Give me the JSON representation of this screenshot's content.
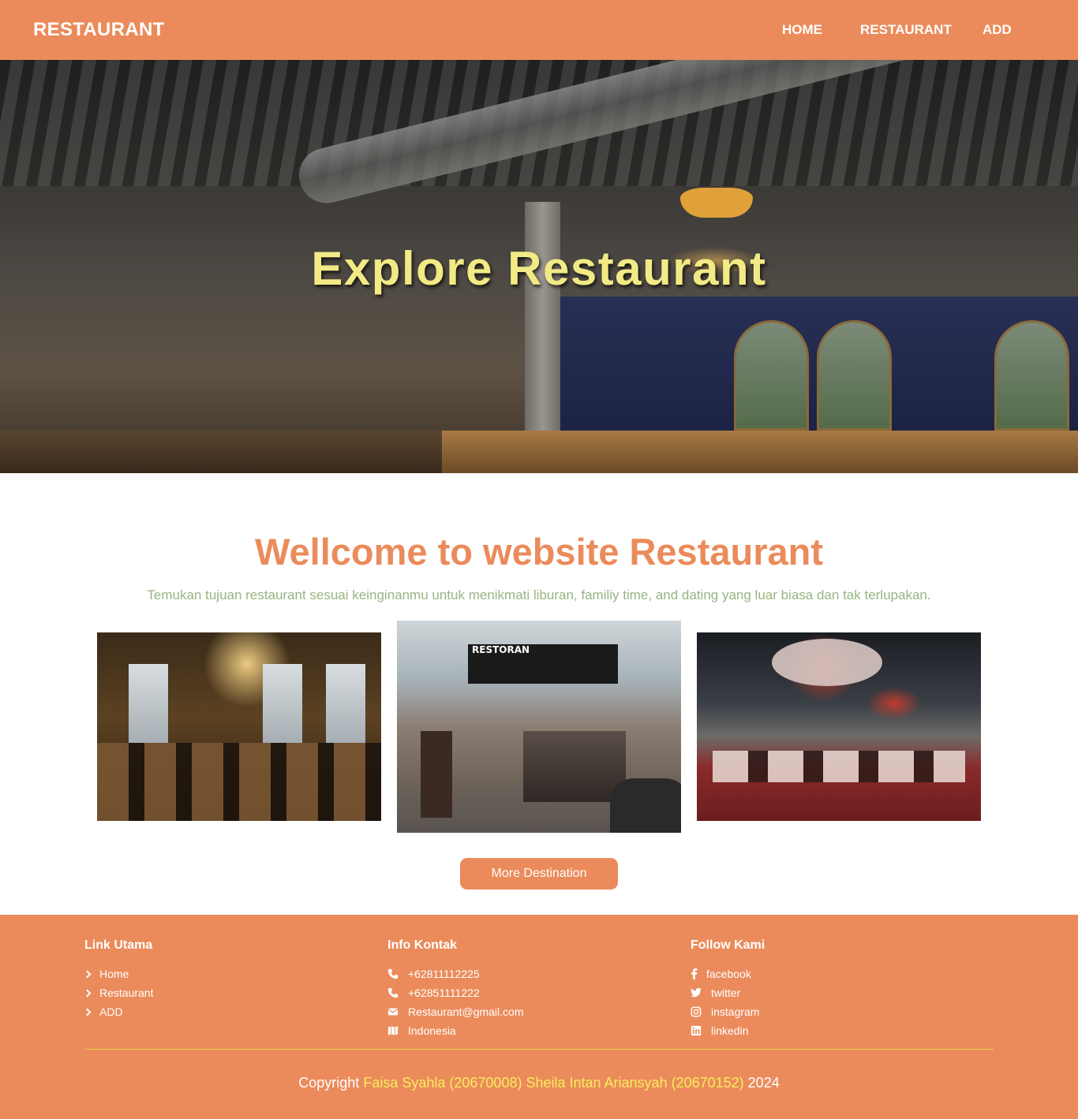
{
  "navbar": {
    "brand": "RESTAURANT",
    "links": [
      "HOME",
      "RESTAURANT",
      "ADD"
    ]
  },
  "hero": {
    "title": "Explore Restaurant"
  },
  "welcome": {
    "title": "Wellcome to website Restaurant",
    "subtitle": "Temukan tujuan restaurant sesuai keinginanmu untuk menikmati liburan, familiy time, and dating yang luar biasa dan tak terlupakan.",
    "photo_2_sign": "RESTORAN",
    "button": "More Destination"
  },
  "footer": {
    "links": {
      "heading": "Link Utama",
      "items": [
        "Home",
        "Restaurant",
        "ADD"
      ]
    },
    "contact": {
      "heading": "Info Kontak",
      "items": [
        "+62811112225",
        "+62851111222",
        "Restaurant@gmail.com",
        "Indonesia"
      ],
      "icons": [
        "phone-icon",
        "phone-icon",
        "envelope-icon",
        "map-icon"
      ]
    },
    "social": {
      "heading": "Follow Kami",
      "items": [
        "facebook",
        "twitter",
        "instagram",
        "linkedin"
      ],
      "icons": [
        "facebook-icon",
        "twitter-icon",
        "instagram-icon",
        "linkedin-icon"
      ]
    },
    "copyright": {
      "prefix": "Copyright",
      "names": "Faisa Syahla (20670008) Sheila Intan Ariansyah (20670152)",
      "year": "2024"
    }
  },
  "colors": {
    "accent": "#eb8b5b",
    "hero_title": "#f2ea84",
    "subtitle": "#97b582",
    "copyright_names": "#f6ee5a"
  }
}
